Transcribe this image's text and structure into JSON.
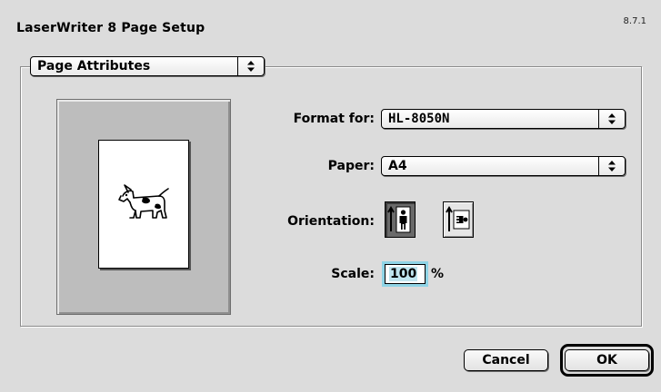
{
  "window": {
    "title": "LaserWriter 8 Page Setup",
    "version": "8.7.1"
  },
  "section_menu": {
    "selected": "Page Attributes"
  },
  "preview": {
    "icon": "dogcow-icon"
  },
  "format_for": {
    "label": "Format for:",
    "value": "HL-8050N"
  },
  "paper": {
    "label": "Paper:",
    "value": "A4"
  },
  "orientation": {
    "label": "Orientation:",
    "options": [
      "portrait",
      "landscape"
    ],
    "selected": "portrait"
  },
  "scale": {
    "label": "Scale:",
    "value": "100",
    "unit": "%"
  },
  "buttons": {
    "cancel": "Cancel",
    "ok": "OK"
  },
  "colors": {
    "window_bg": "#dcdcdc",
    "focus_ring": "#8fd4e6",
    "selected_orientation_bg": "#6a6a6a"
  }
}
